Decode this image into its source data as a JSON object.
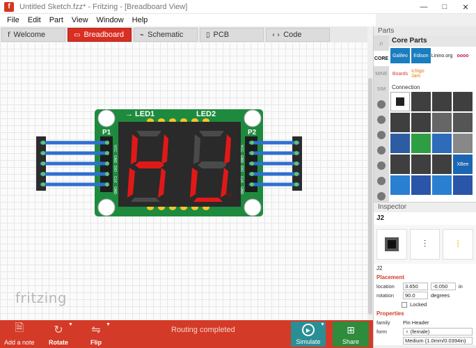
{
  "window": {
    "title": "Untitled Sketch.fzz* - Fritzing - [Breadboard View]",
    "app_icon": "f",
    "controls": [
      "—",
      "□",
      "✕"
    ]
  },
  "menu": [
    "File",
    "Edit",
    "Part",
    "View",
    "Window",
    "Help"
  ],
  "tabs": [
    {
      "label": "Welcome",
      "icon": "f"
    },
    {
      "label": "Breadboard",
      "icon": "▭"
    },
    {
      "label": "Schematic",
      "icon": "⌁"
    },
    {
      "label": "PCB",
      "icon": "▯"
    },
    {
      "label": "Code",
      "icon": "‹ ›"
    }
  ],
  "board": {
    "header_left": "P1",
    "header_right": "P2",
    "led1": "→ LED1",
    "led2": "LED2",
    "pin_labels": [
      "VCC",
      "GND",
      "DIO",
      "CLK",
      "GND"
    ],
    "colors": {
      "pcb": "#1e8a3e",
      "segment_on": "#e11818",
      "segment_off": "#4a4a4a",
      "wire": "#2f6fd1",
      "pad": "#f4c52b"
    }
  },
  "canvas": {
    "watermark": "fritzing"
  },
  "bottom_bar": {
    "add_note": "Add a note",
    "rotate": "Rotate",
    "flip": "Flip",
    "status": "Routing completed",
    "simulate": "Simulate",
    "share": "Share"
  },
  "parts": {
    "header": "Parts",
    "bins": [
      "CORE",
      "MINE",
      "SIM"
    ],
    "title": "Core Parts",
    "brands": [
      "Galileo",
      "Edison",
      "Linino.org",
      "oooo",
      "Boards",
      "Ichigo Jam"
    ],
    "section": "Connection"
  },
  "inspector": {
    "header": "Inspector",
    "part_name": "J2",
    "label": "J2",
    "placement_title": "Placement",
    "location_label": "location",
    "location_x": "3.650",
    "location_y": "-0.050",
    "location_unit": "in",
    "rotation_label": "rotation",
    "rotation_value": "90.0",
    "rotation_unit": "degrees",
    "locked_label": "Locked",
    "properties_title": "Properties",
    "family_label": "family",
    "family_value": "Pin Header",
    "form_label": "form",
    "form_value": "♀ (female)",
    "size_value": "Medium (1.0mm/0.0394in)"
  }
}
